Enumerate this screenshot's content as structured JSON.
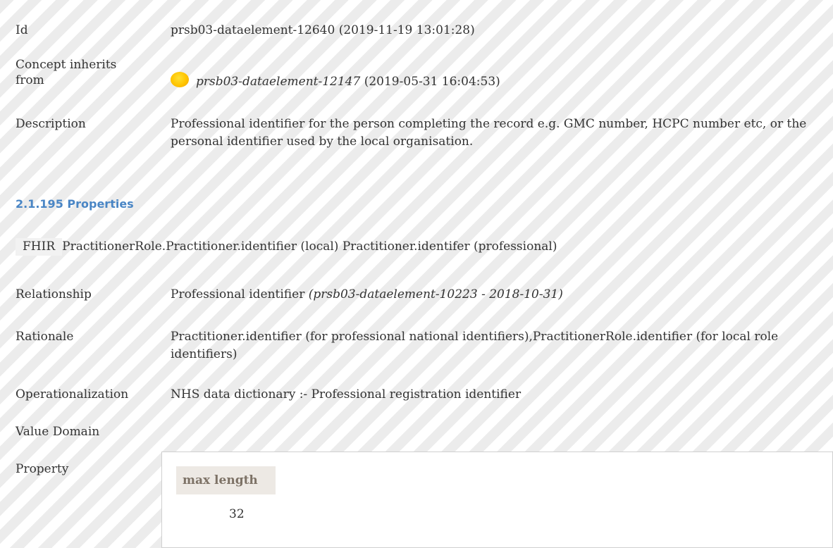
{
  "id": {
    "label": "Id",
    "value": "prsb03-dataelement-12640 (2019-11-19 13:01:28)"
  },
  "concept": {
    "label": "Concept inherits from",
    "link_text": "prsb03-dataelement-12147",
    "date": " (2019-05-31 16:04:53)",
    "status_icon": "yellow-circle-icon"
  },
  "description": {
    "label": "Description",
    "text": "Professional identifier for the person completing the record e.g. GMC number, HCPC number etc, or the personal identifier used by the local organisation."
  },
  "section": {
    "heading": "2.1.195 Properties"
  },
  "fhir": {
    "badge": "FHIR",
    "value": "PractitionerRole.Practitioner.identifier (local) Practitioner.identifer (professional)"
  },
  "relationship": {
    "label": "Relationship",
    "text": "Professional identifier ",
    "ref": "(prsb03-dataelement-10223 - 2018-10-31)"
  },
  "rationale": {
    "label": "Rationale",
    "text": "Practitioner.identifier (for professional national identifiers),PractitionerRole.identifier (for local role identifiers)"
  },
  "operationalization": {
    "label": "Operationalization",
    "text": "NHS data dictionary :- Professional registration identifier"
  },
  "value_domain": {
    "label": "Value Domain"
  },
  "property": {
    "label": "Property",
    "column_header": "max length",
    "value": "32"
  },
  "colors": {
    "section_heading": "#4a86c5",
    "status_icon": "#ffc400",
    "property_header_bg": "#ede9e4"
  }
}
